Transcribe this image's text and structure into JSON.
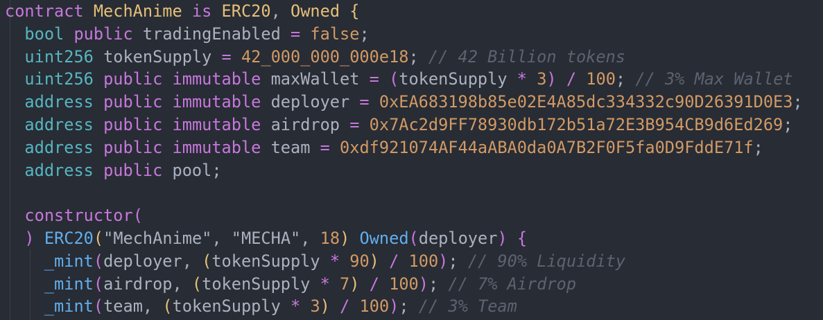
{
  "editor": {
    "language": "solidity",
    "theme": {
      "background": "#282c34",
      "keyword": "#c678dd",
      "type": "#56b6c2",
      "function": "#61afef",
      "class": "#e5c07b",
      "number": "#d19a66",
      "comment": "#5c6370",
      "text": "#abb2bf"
    },
    "lines": [
      [
        {
          "t": "kw",
          "v": "contract "
        },
        {
          "t": "cls",
          "v": "MechAnime"
        },
        {
          "t": "plain",
          "v": " "
        },
        {
          "t": "kw",
          "v": "is"
        },
        {
          "t": "plain",
          "v": " "
        },
        {
          "t": "cls",
          "v": "ERC20"
        },
        {
          "t": "plain",
          "v": ", "
        },
        {
          "t": "cls",
          "v": "Owned"
        },
        {
          "t": "plain",
          "v": " "
        },
        {
          "t": "br",
          "v": "{"
        }
      ],
      [
        {
          "t": "plain",
          "v": "  "
        },
        {
          "t": "ty",
          "v": "bool"
        },
        {
          "t": "plain",
          "v": " "
        },
        {
          "t": "kw",
          "v": "public"
        },
        {
          "t": "plain",
          "v": " tradingEnabled "
        },
        {
          "t": "op",
          "v": "="
        },
        {
          "t": "plain",
          "v": " "
        },
        {
          "t": "num",
          "v": "false"
        },
        {
          "t": "plain",
          "v": ";"
        }
      ],
      [
        {
          "t": "plain",
          "v": "  "
        },
        {
          "t": "ty",
          "v": "uint256"
        },
        {
          "t": "plain",
          "v": " tokenSupply "
        },
        {
          "t": "op",
          "v": "="
        },
        {
          "t": "plain",
          "v": " "
        },
        {
          "t": "num",
          "v": "42_000_000_000e18"
        },
        {
          "t": "plain",
          "v": "; "
        },
        {
          "t": "cm",
          "v": "// 42 Billion tokens"
        }
      ],
      [
        {
          "t": "plain",
          "v": "  "
        },
        {
          "t": "ty",
          "v": "uint256"
        },
        {
          "t": "plain",
          "v": " "
        },
        {
          "t": "kw",
          "v": "public"
        },
        {
          "t": "plain",
          "v": " "
        },
        {
          "t": "kw",
          "v": "immutable"
        },
        {
          "t": "plain",
          "v": " maxWallet "
        },
        {
          "t": "op",
          "v": "="
        },
        {
          "t": "plain",
          "v": " "
        },
        {
          "t": "paren",
          "v": "("
        },
        {
          "t": "plain",
          "v": "tokenSupply "
        },
        {
          "t": "op",
          "v": "*"
        },
        {
          "t": "plain",
          "v": " "
        },
        {
          "t": "num",
          "v": "3"
        },
        {
          "t": "paren",
          "v": ")"
        },
        {
          "t": "plain",
          "v": " "
        },
        {
          "t": "op",
          "v": "/"
        },
        {
          "t": "plain",
          "v": " "
        },
        {
          "t": "num",
          "v": "100"
        },
        {
          "t": "plain",
          "v": "; "
        },
        {
          "t": "cm",
          "v": "// 3% Max Wallet"
        }
      ],
      [
        {
          "t": "plain",
          "v": "  "
        },
        {
          "t": "ty",
          "v": "address"
        },
        {
          "t": "plain",
          "v": " "
        },
        {
          "t": "kw",
          "v": "public"
        },
        {
          "t": "plain",
          "v": " "
        },
        {
          "t": "kw",
          "v": "immutable"
        },
        {
          "t": "plain",
          "v": " deployer "
        },
        {
          "t": "op",
          "v": "="
        },
        {
          "t": "plain",
          "v": " "
        },
        {
          "t": "num",
          "v": "0xEA683198b85e02E4A85dc334332c90D26391D0E3"
        },
        {
          "t": "plain",
          "v": ";"
        }
      ],
      [
        {
          "t": "plain",
          "v": "  "
        },
        {
          "t": "ty",
          "v": "address"
        },
        {
          "t": "plain",
          "v": " "
        },
        {
          "t": "kw",
          "v": "public"
        },
        {
          "t": "plain",
          "v": " "
        },
        {
          "t": "kw",
          "v": "immutable"
        },
        {
          "t": "plain",
          "v": " airdrop "
        },
        {
          "t": "op",
          "v": "="
        },
        {
          "t": "plain",
          "v": " "
        },
        {
          "t": "num",
          "v": "0x7Ac2d9FF78930db172b51a72E3B954CB9d6Ed269"
        },
        {
          "t": "plain",
          "v": ";"
        }
      ],
      [
        {
          "t": "plain",
          "v": "  "
        },
        {
          "t": "ty",
          "v": "address"
        },
        {
          "t": "plain",
          "v": " "
        },
        {
          "t": "kw",
          "v": "public"
        },
        {
          "t": "plain",
          "v": " "
        },
        {
          "t": "kw",
          "v": "immutable"
        },
        {
          "t": "plain",
          "v": " team "
        },
        {
          "t": "op",
          "v": "="
        },
        {
          "t": "plain",
          "v": " "
        },
        {
          "t": "num",
          "v": "0xdf921074AF44aABA0da0A7B2F0F5fa0D9FddE71f"
        },
        {
          "t": "plain",
          "v": ";"
        }
      ],
      [
        {
          "t": "plain",
          "v": "  "
        },
        {
          "t": "ty",
          "v": "address"
        },
        {
          "t": "plain",
          "v": " "
        },
        {
          "t": "kw",
          "v": "public"
        },
        {
          "t": "plain",
          "v": " pool;"
        }
      ],
      [
        {
          "t": "plain",
          "v": ""
        }
      ],
      [
        {
          "t": "plain",
          "v": "  "
        },
        {
          "t": "kw",
          "v": "constructor"
        },
        {
          "t": "paren",
          "v": "("
        }
      ],
      [
        {
          "t": "plain",
          "v": "  "
        },
        {
          "t": "paren",
          "v": ")"
        },
        {
          "t": "plain",
          "v": " "
        },
        {
          "t": "fn",
          "v": "ERC20"
        },
        {
          "t": "paren2",
          "v": "("
        },
        {
          "t": "str",
          "v": "\"MechAnime\""
        },
        {
          "t": "plain",
          "v": ", "
        },
        {
          "t": "str",
          "v": "\"MECHA\""
        },
        {
          "t": "plain",
          "v": ", "
        },
        {
          "t": "num",
          "v": "18"
        },
        {
          "t": "paren2",
          "v": ")"
        },
        {
          "t": "plain",
          "v": " "
        },
        {
          "t": "fn",
          "v": "Owned"
        },
        {
          "t": "paren",
          "v": "("
        },
        {
          "t": "plain",
          "v": "deployer"
        },
        {
          "t": "paren",
          "v": ")"
        },
        {
          "t": "plain",
          "v": " "
        },
        {
          "t": "kw",
          "v": "{"
        }
      ],
      [
        {
          "t": "plain",
          "v": "    "
        },
        {
          "t": "fn",
          "v": "_mint"
        },
        {
          "t": "paren",
          "v": "("
        },
        {
          "t": "plain",
          "v": "deployer, "
        },
        {
          "t": "paren2",
          "v": "("
        },
        {
          "t": "plain",
          "v": "tokenSupply "
        },
        {
          "t": "op",
          "v": "*"
        },
        {
          "t": "plain",
          "v": " "
        },
        {
          "t": "num",
          "v": "90"
        },
        {
          "t": "paren2",
          "v": ")"
        },
        {
          "t": "plain",
          "v": " "
        },
        {
          "t": "op",
          "v": "/"
        },
        {
          "t": "plain",
          "v": " "
        },
        {
          "t": "num",
          "v": "100"
        },
        {
          "t": "paren",
          "v": ")"
        },
        {
          "t": "plain",
          "v": "; "
        },
        {
          "t": "cm",
          "v": "// 90% Liquidity"
        }
      ],
      [
        {
          "t": "plain",
          "v": "    "
        },
        {
          "t": "fn",
          "v": "_mint"
        },
        {
          "t": "paren",
          "v": "("
        },
        {
          "t": "plain",
          "v": "airdrop, "
        },
        {
          "t": "paren2",
          "v": "("
        },
        {
          "t": "plain",
          "v": "tokenSupply "
        },
        {
          "t": "op",
          "v": "*"
        },
        {
          "t": "plain",
          "v": " "
        },
        {
          "t": "num",
          "v": "7"
        },
        {
          "t": "paren2",
          "v": ")"
        },
        {
          "t": "plain",
          "v": " "
        },
        {
          "t": "op",
          "v": "/"
        },
        {
          "t": "plain",
          "v": " "
        },
        {
          "t": "num",
          "v": "100"
        },
        {
          "t": "paren",
          "v": ")"
        },
        {
          "t": "plain",
          "v": "; "
        },
        {
          "t": "cm",
          "v": "// 7% Airdrop"
        }
      ],
      [
        {
          "t": "plain",
          "v": "    "
        },
        {
          "t": "fn",
          "v": "_mint"
        },
        {
          "t": "paren",
          "v": "("
        },
        {
          "t": "plain",
          "v": "team, "
        },
        {
          "t": "paren2",
          "v": "("
        },
        {
          "t": "plain",
          "v": "tokenSupply "
        },
        {
          "t": "op",
          "v": "*"
        },
        {
          "t": "plain",
          "v": " "
        },
        {
          "t": "num",
          "v": "3"
        },
        {
          "t": "paren2",
          "v": ")"
        },
        {
          "t": "plain",
          "v": " "
        },
        {
          "t": "op",
          "v": "/"
        },
        {
          "t": "plain",
          "v": " "
        },
        {
          "t": "num",
          "v": "100"
        },
        {
          "t": "paren",
          "v": ")"
        },
        {
          "t": "plain",
          "v": "; "
        },
        {
          "t": "cm",
          "v": "// 3% Team"
        }
      ]
    ]
  }
}
